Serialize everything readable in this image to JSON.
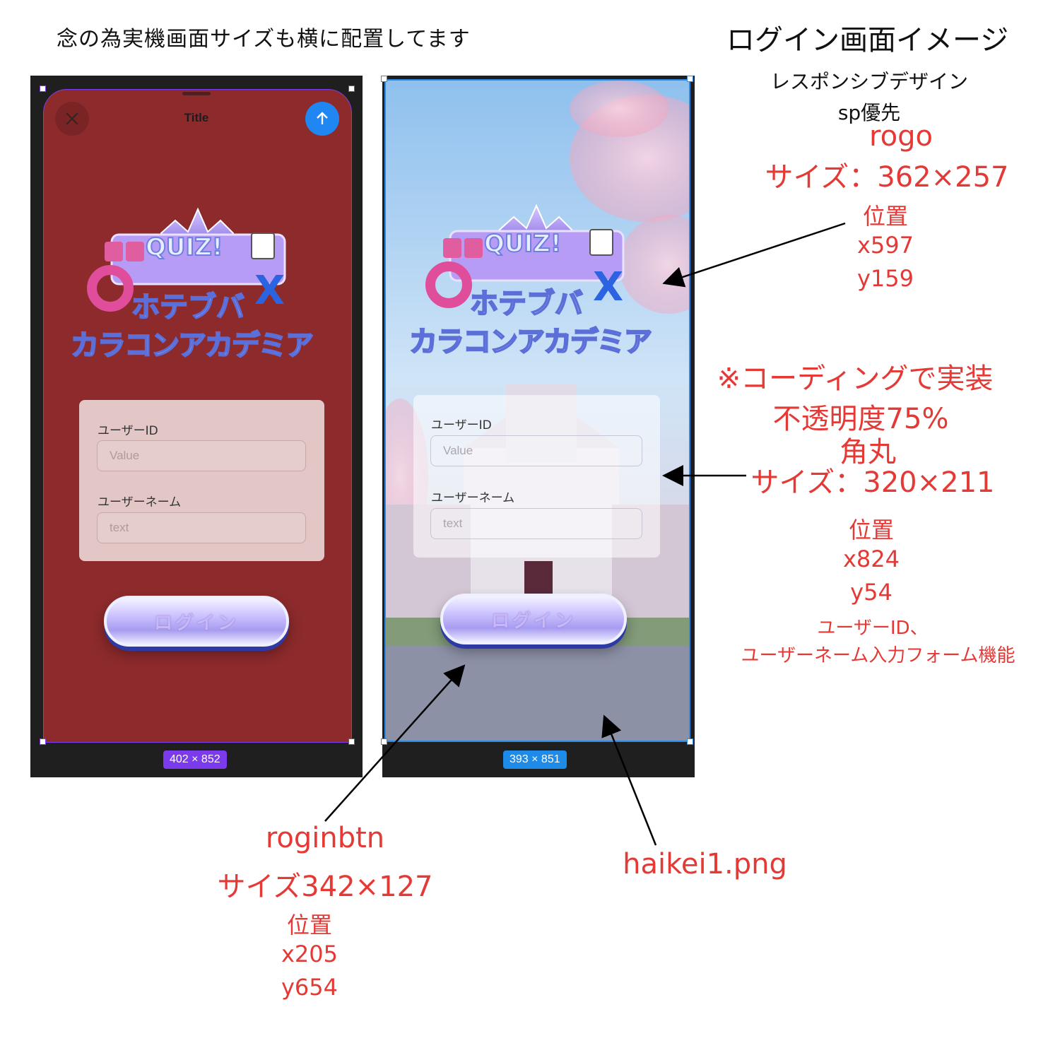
{
  "header": {
    "left_note": "念の為実機画面サイズも横に配置してます",
    "title": "ログイン画面イメージ",
    "subtitle1": "レスポンシブデザイン",
    "subtitle2": "sp優先"
  },
  "left_phone": {
    "sheet_title": "Title",
    "size_badge": "402 × 852",
    "badge_color": "#7c3aed",
    "bg_color": "#8d2a2c"
  },
  "right_phone": {
    "size_badge": "393 × 851",
    "badge_color": "#1f8be8"
  },
  "logo": {
    "top_text": "QUIZ!",
    "line1": "ホテブバ",
    "line2": "カラコンアカデミア"
  },
  "form": {
    "user_id_label": "ユーザーID",
    "user_id_placeholder": "Value",
    "user_name_label": "ユーザーネーム",
    "user_name_placeholder": "text"
  },
  "login_button": {
    "label": "ログイン"
  },
  "annotations": {
    "rogo": {
      "name": "rogo",
      "size": "サイズ：362×257",
      "pos_label": "位置",
      "x": "x597",
      "y": "y159"
    },
    "form": {
      "note": "※コーディングで実装",
      "opacity": "不透明度75%",
      "radius": "角丸",
      "size": "サイズ：320×211",
      "pos_label": "位置",
      "x": "x824",
      "y": "y54",
      "func1": "ユーザーID、",
      "func2": "ユーザーネーム入力フォーム機能"
    },
    "btn": {
      "name": "roginbtn",
      "size": "サイズ342×127",
      "pos_label": "位置",
      "x": "x205",
      "y": "y654"
    },
    "bg": {
      "name": "haikei1.png"
    }
  },
  "colors": {
    "annotation": "#e53935",
    "accent_blue": "#1f86f2"
  }
}
